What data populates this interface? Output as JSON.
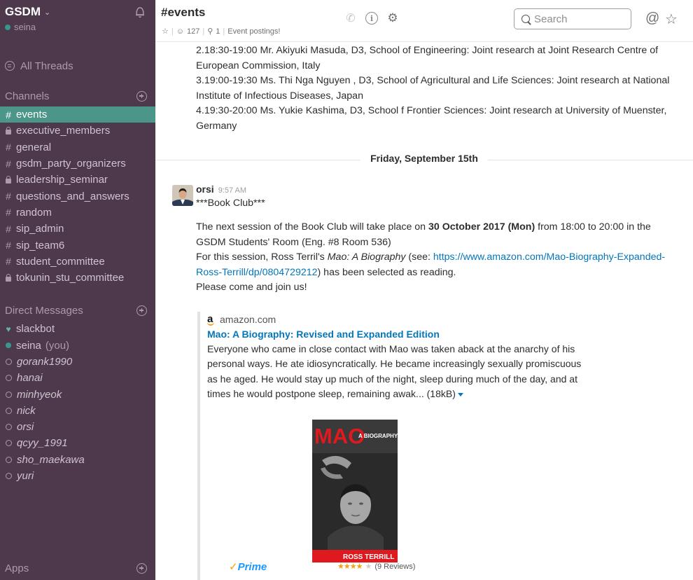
{
  "team": {
    "name": "GSDM",
    "user": "seina"
  },
  "sidebar": {
    "all_threads": "All Threads",
    "channels_header": "Channels",
    "channels": [
      {
        "name": "events",
        "private": false,
        "active": true
      },
      {
        "name": "executive_members",
        "private": true,
        "active": false
      },
      {
        "name": "general",
        "private": false,
        "active": false
      },
      {
        "name": "gsdm_party_organizers",
        "private": false,
        "active": false
      },
      {
        "name": "leadership_seminar",
        "private": true,
        "active": false
      },
      {
        "name": "questions_and_answers",
        "private": false,
        "active": false
      },
      {
        "name": "random",
        "private": false,
        "active": false
      },
      {
        "name": "sip_admin",
        "private": false,
        "active": false
      },
      {
        "name": "sip_team6",
        "private": false,
        "active": false
      },
      {
        "name": "student_committee",
        "private": false,
        "active": false
      },
      {
        "name": "tokunin_stu_committee",
        "private": true,
        "active": false
      }
    ],
    "dm_header": "Direct Messages",
    "dms": [
      {
        "name": "slackbot",
        "status": "bot"
      },
      {
        "name": "seina",
        "status": "online",
        "suffix": "(you)"
      },
      {
        "name": "gorank1990",
        "status": "offline"
      },
      {
        "name": "hanai",
        "status": "offline"
      },
      {
        "name": "minhyeok",
        "status": "offline"
      },
      {
        "name": "nick",
        "status": "offline"
      },
      {
        "name": "orsi",
        "status": "offline"
      },
      {
        "name": "qcyy_1991",
        "status": "offline"
      },
      {
        "name": "sho_maekawa",
        "status": "offline"
      },
      {
        "name": "yuri",
        "status": "offline"
      }
    ],
    "apps_header": "Apps"
  },
  "header": {
    "title": "#events",
    "members": "127",
    "pinned": "1",
    "purpose": "Event postings!",
    "search_placeholder": "Search"
  },
  "previous_message": {
    "lines": [
      "2.18:30-19:00 Mr. Akiyuki Masuda, D3, School of Engineering: Joint research at Joint Research Centre of European Commission, Italy",
      "3.19:00-19:30 Ms. Thi Nga Nguyen , D3, School of Agricultural and Life Sciences: Joint research at National Institute of Infectious Diseases, Japan",
      "4.19:30-20:00 Ms. Yukie Kashima, D3, School f Frontier Sciences: Joint research at University of Muenster, Germany"
    ]
  },
  "day_divider": "Friday, September 15th",
  "message": {
    "author": "orsi",
    "time": "9:57 AM",
    "line1": "***Book Club***",
    "p1_a": "The next session of the Book Club will take place on ",
    "p1_bold": "30 October 2017 (Mon)",
    "p1_b": " from 18:00 to 20:00 in the GSDM Students' Room (Eng. #8 Room 536)",
    "p2_a": "For this session, Ross Terril's ",
    "p2_italic": "Mao: A Biography",
    "p2_b": " (see: ",
    "p2_link": "https://www.amazon.com/Mao-Biography-Expanded-Ross-Terrill/dp/0804729212",
    "p2_c": ") has been selected as reading.",
    "p3": "Please come and join us!"
  },
  "attachment": {
    "source": "amazon.com",
    "title": "Mao: A Biography: Revised and Expanded Edition",
    "description": "Everyone who came in close contact with Mao was taken aback at the anarchy of his personal ways. He ate idiosyncratically. He became increasingly sexually promiscuous as he aged. He would stay up much of the night, sleep during much of the day, and at times he would postpone sleep, remaining awak...",
    "size": "(18kB)",
    "cover_title": "MAO",
    "cover_subtitle": "A BIOGRAPHY",
    "cover_author": "ROSS TERRILL",
    "prime_label": "Prime",
    "rating_stars": 4,
    "reviews": "(9 Reviews)"
  },
  "colors": {
    "sidebar_bg": "#4d394b",
    "active_channel": "#4c9689",
    "link": "#0576b9",
    "presence": "#38978d"
  }
}
